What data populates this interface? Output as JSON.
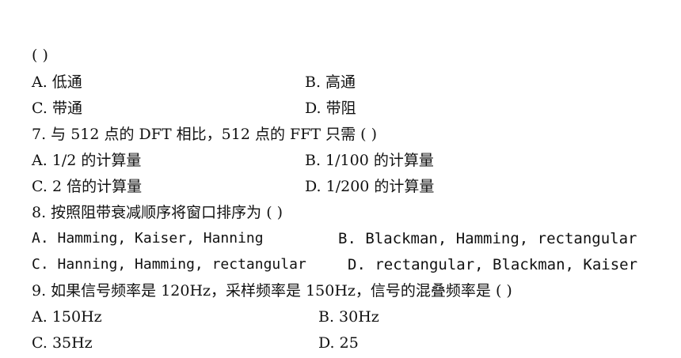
{
  "lines": [
    {
      "text": "(     )"
    },
    {
      "text": "A. 低通",
      "right": "B. 高通"
    },
    {
      "text": "C. 带通",
      "right": "D. 带阻"
    },
    {
      "text": "7. 与 512 点的 DFT 相比，512 点的 FFT 只需 (     )"
    },
    {
      "text": "A. 1/2 的计算量",
      "right": "B. 1/100 的计算量"
    },
    {
      "text": "C. 2 倍的计算量",
      "right": "D. 1/200 的计算量"
    },
    {
      "text": "8. 按照阻带衰减顺序将窗口排序为 (     )"
    },
    {
      "text": "A. Hamming, Kaiser, Hanning",
      "right": "B. Blackman, Hamming, rectangular"
    },
    {
      "text": "C. Hanning, Hamming, rectangular",
      "right": "D. rectangular, Blackman, Kaiser"
    },
    {
      "text": "9. 如果信号频率是 120Hz，采样频率是 150Hz，信号的混叠频率是 (     )"
    },
    {
      "text": "A. 150Hz",
      "right": "B. 30Hz"
    },
    {
      "text": "C. 35Hz",
      "right": "D. 25"
    }
  ]
}
